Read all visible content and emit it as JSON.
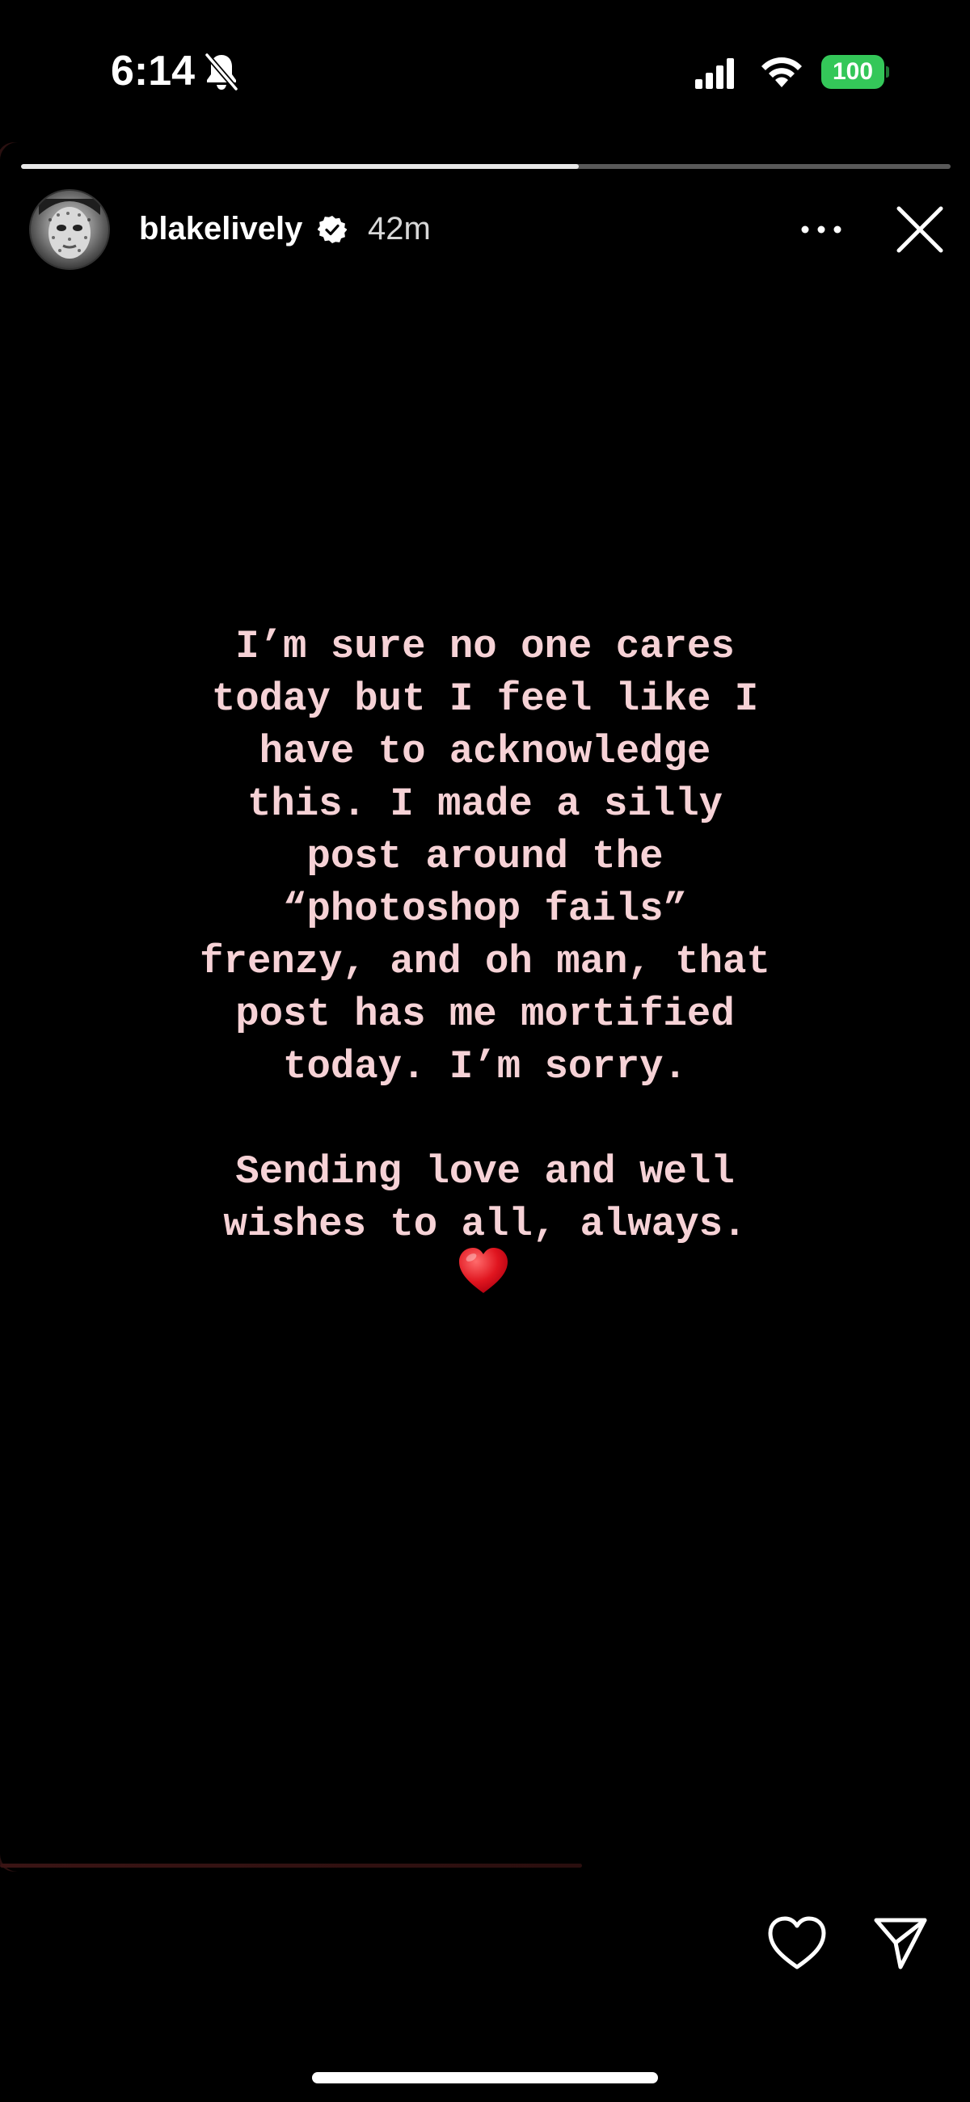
{
  "status_bar": {
    "time": "6:14",
    "battery_level": "100",
    "icons": [
      "bell-slash-icon",
      "cellular-signal-icon",
      "wifi-icon",
      "battery-icon"
    ],
    "battery_color": "#34c759"
  },
  "story": {
    "progress_fraction": 0.6,
    "username": "blakelively",
    "verified": true,
    "time_ago": "42m",
    "text": "I’m sure no one cares\ntoday but I feel like I\nhave to acknowledge\nthis. I made a silly\npost around the\n“photoshop fails”\nfrenzy, and oh man, that\npost has me mortified\ntoday. I’m sorry.\n\nSending love and well\nwishes to all, always.",
    "emoji": "heart-emoji",
    "text_color": "#f6d2d6"
  },
  "actions": {
    "icons": [
      "more-options-icon",
      "close-icon",
      "heart-like-icon",
      "send-share-icon"
    ]
  }
}
